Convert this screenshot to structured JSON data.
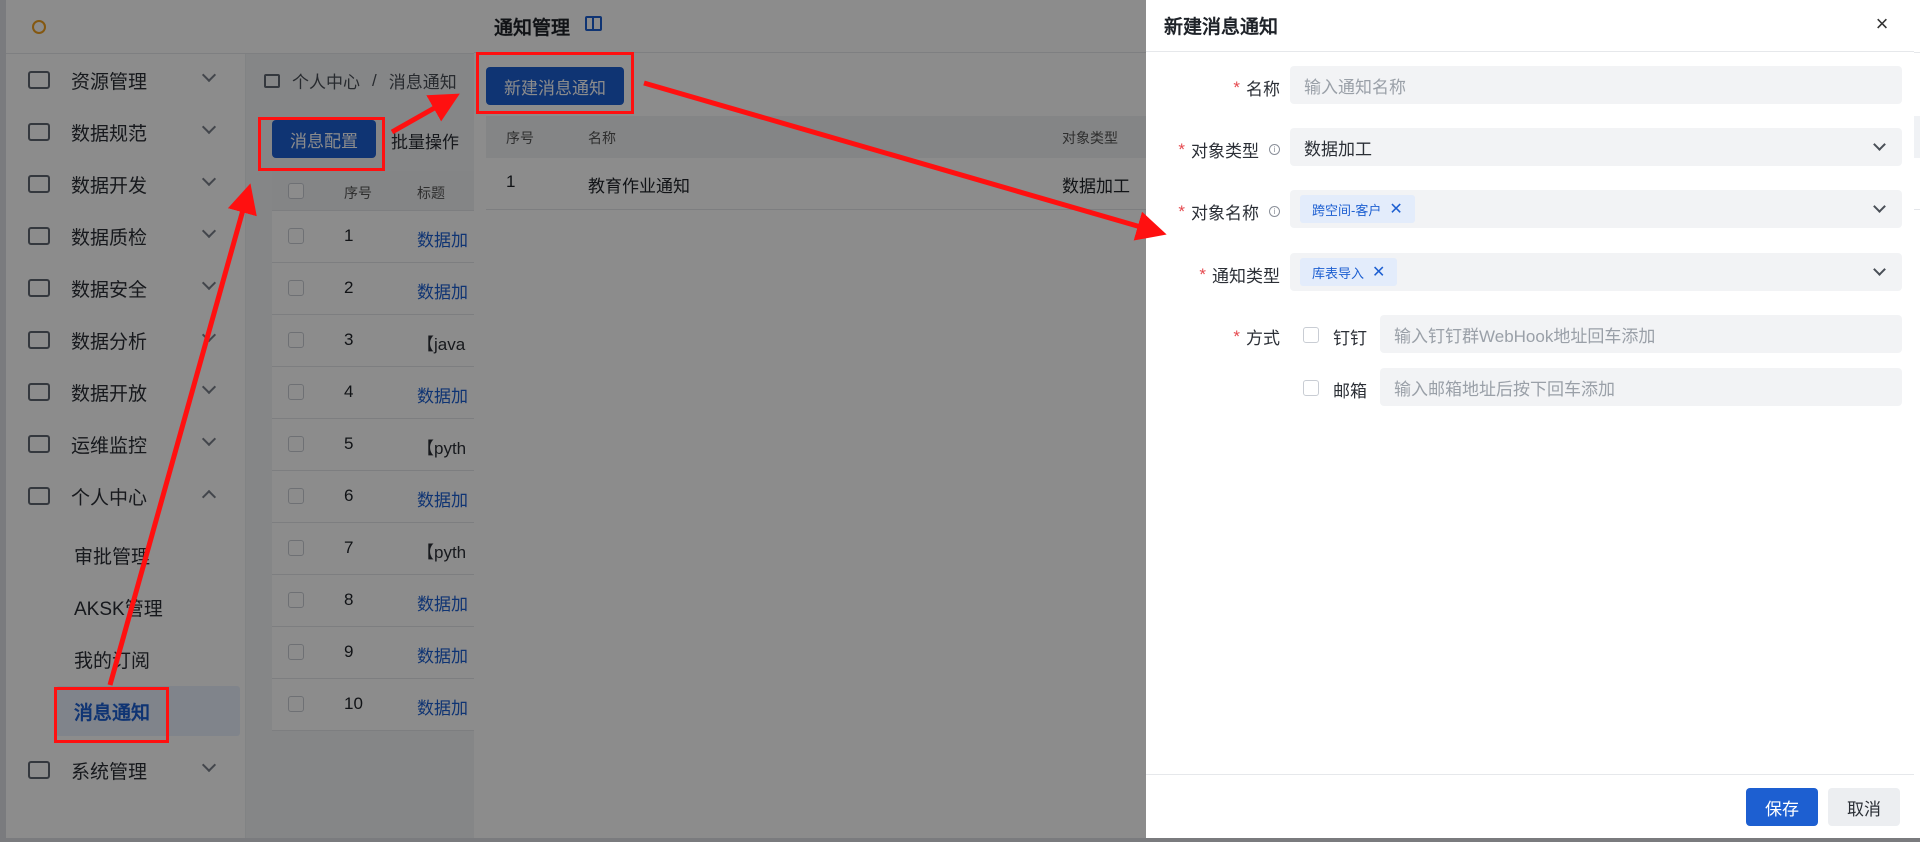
{
  "sidebar": {
    "items": [
      {
        "label": "资源管理"
      },
      {
        "label": "数据规范"
      },
      {
        "label": "数据开发"
      },
      {
        "label": "数据质检"
      },
      {
        "label": "数据安全"
      },
      {
        "label": "数据分析"
      },
      {
        "label": "数据开放"
      },
      {
        "label": "运维监控"
      },
      {
        "label": "个人中心"
      },
      {
        "label": "系统管理"
      }
    ],
    "sub_items": [
      {
        "label": "审批管理"
      },
      {
        "label": "AKSK管理"
      },
      {
        "label": "我的订阅"
      },
      {
        "label": "消息通知"
      }
    ]
  },
  "breadcrumb": {
    "root": "个人中心",
    "sep": "/",
    "current": "消息通知"
  },
  "content": {
    "config_button": "消息配置",
    "batch_label": "批量操作",
    "table": {
      "headers": {
        "seq": "序号",
        "title": "标题"
      },
      "rows": [
        {
          "seq": "1",
          "title": "数据加"
        },
        {
          "seq": "2",
          "title": "数据加"
        },
        {
          "seq": "3",
          "title": "【java"
        },
        {
          "seq": "4",
          "title": "数据加"
        },
        {
          "seq": "5",
          "title": "【pyth"
        },
        {
          "seq": "6",
          "title": "数据加"
        },
        {
          "seq": "7",
          "title": "【pyth"
        },
        {
          "seq": "8",
          "title": "数据加"
        },
        {
          "seq": "9",
          "title": "数据加"
        },
        {
          "seq": "10",
          "title": "数据加"
        }
      ]
    }
  },
  "notice_drawer": {
    "title": "通知管理",
    "new_button": "新建消息通知",
    "table": {
      "headers": {
        "seq": "序号",
        "name": "名称",
        "type": "对象类型"
      },
      "rows": [
        {
          "seq": "1",
          "name": "教育作业通知",
          "type": "数据加工"
        }
      ]
    }
  },
  "form_drawer": {
    "title": "新建消息通知",
    "close": "×",
    "fields": {
      "name": {
        "label": "名称",
        "placeholder": "输入通知名称"
      },
      "object_type": {
        "label": "对象类型",
        "value": "数据加工"
      },
      "object_name": {
        "label": "对象名称",
        "tag": "跨空间-客户"
      },
      "notify_type": {
        "label": "通知类型",
        "tag": "库表导入"
      },
      "method": {
        "label": "方式",
        "dingtalk": {
          "label": "钉钉",
          "placeholder": "输入钉钉群WebHook地址回车添加"
        },
        "email": {
          "label": "邮箱",
          "placeholder": "输入邮箱地址后按下回车添加"
        }
      }
    },
    "required_mark": "*",
    "info_mark": "i",
    "tag_close": "✕",
    "save": "保存",
    "cancel": "取消"
  },
  "colors": {
    "primary": "#1d5fd1",
    "annotation": "#ff1010",
    "required": "#e5484d"
  }
}
